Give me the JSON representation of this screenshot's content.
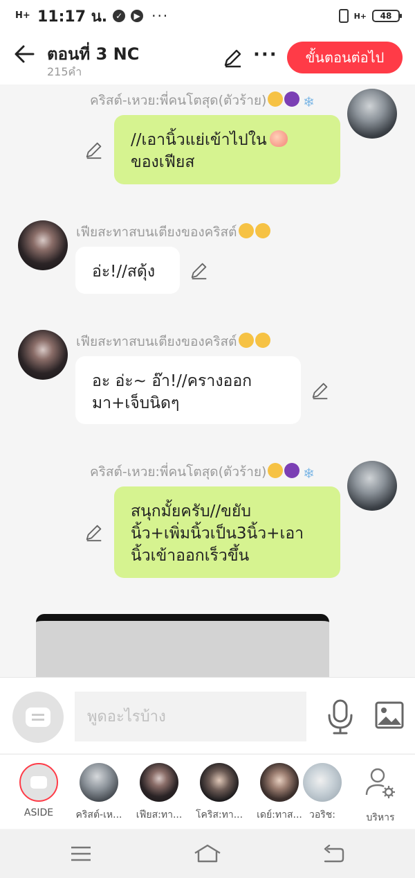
{
  "status_bar": {
    "time": "11:17 น.",
    "signal_label": "H+",
    "net_label": "H+",
    "battery": "48",
    "more": "···"
  },
  "header": {
    "title": "ตอนที่ 3 NC",
    "subtitle": "215คำ",
    "next_label": "ขั้นตอนต่อไป",
    "more_label": "···"
  },
  "messages": [
    {
      "side": "right",
      "sender": "คริสต์-เหวย:พี่คนโตสุด(ตัวร้าย)",
      "lines": [
        "//เอานิ้วแย่เข้าไปใน",
        "ของเฟียส"
      ]
    },
    {
      "side": "left",
      "sender": "เฟียสะทาสบนเตียงของคริสต์",
      "lines": [
        "อ่ะ!//สดุ้ง"
      ]
    },
    {
      "side": "left",
      "sender": "เฟียสะทาสบนเตียงของคริสต์",
      "lines": [
        "อะ อ่ะ~ อ๊า!//ครางออก",
        "มา+เจ็บนิดๆ"
      ]
    },
    {
      "side": "right",
      "sender": "คริสต์-เหวย:พี่คนโตสุด(ตัวร้าย)",
      "lines": [
        "สนุกมั้ยครับ//ขยับ",
        "นิ้ว+เพิ่มนิ้วเป็น3นิ้ว+เอา",
        "นิ้วเข้าออกเร็วขึ้น"
      ]
    }
  ],
  "input": {
    "placeholder": "พูดอะไรบ้าง"
  },
  "characters": [
    {
      "label": "ASIDE"
    },
    {
      "label": "คริสต์-เห..."
    },
    {
      "label": "เฟียส:ทา..."
    },
    {
      "label": "โคริส:ทา..."
    },
    {
      "label": "เดย์:ทาส..."
    },
    {
      "label": "วอริช:"
    },
    {
      "label": "บริหาร"
    }
  ],
  "colors": {
    "accent": "#ff3b47",
    "green_bubble": "#d6f390"
  },
  "icons": [
    "back-arrow-icon",
    "pencil-icon",
    "more-icon",
    "microphone-icon",
    "image-icon",
    "menu-icon",
    "home-icon",
    "return-icon",
    "user-gear-icon"
  ]
}
